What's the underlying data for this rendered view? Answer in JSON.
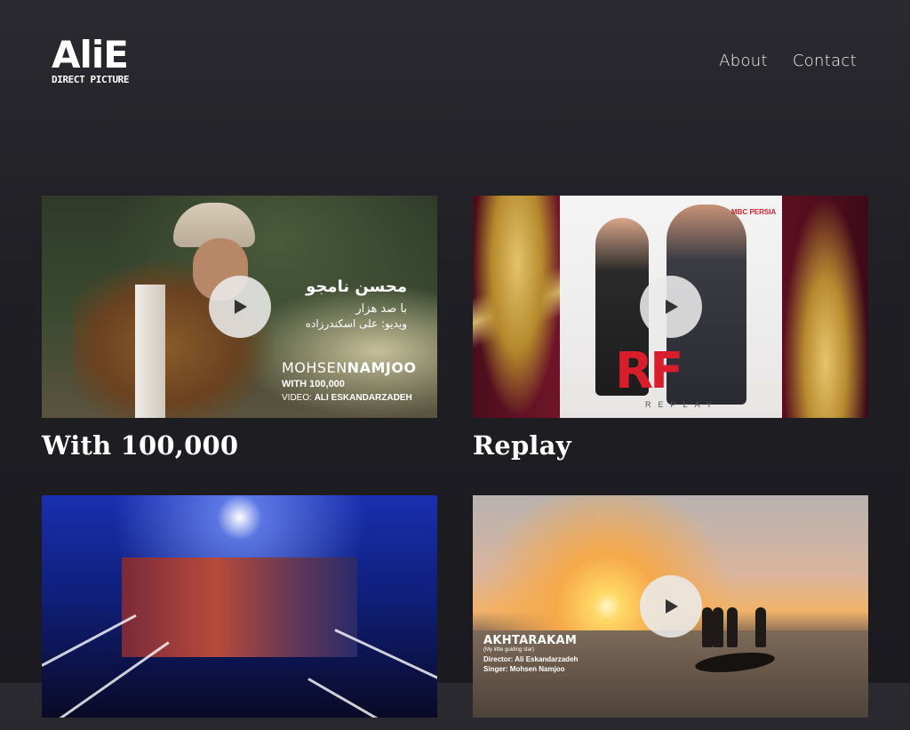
{
  "header": {
    "logo_main": "AliE",
    "logo_sub": "DIRECT PICTURE",
    "nav": [
      {
        "label": "About"
      },
      {
        "label": "Contact"
      }
    ]
  },
  "videos": [
    {
      "title": "With 100,000",
      "thumb_text": {
        "fa_title": "محسن نامجو",
        "fa_sub": "با صد هزار",
        "fa_credit": "ویدیو: علی اسکندرزاده",
        "artist_first": "MOHSEN",
        "artist_last": "NAMJOO",
        "song": "WITH 100,000",
        "credit_prefix": "VIDEO:",
        "credit": "ALI ESKANDARZADEH"
      }
    },
    {
      "title": "Replay",
      "thumb_text": {
        "logo": "RF",
        "word": "REPLAY",
        "badge": "MBC PERSIA"
      }
    },
    {
      "title": "",
      "thumb_text": {}
    },
    {
      "title": "",
      "thumb_text": {
        "song": "AKHTARAKAM",
        "subtitle": "(My little guiding star)",
        "director": "Director: Ali Eskandarzadeh",
        "singer": "Singer: Mohsen Namjoo"
      }
    }
  ]
}
